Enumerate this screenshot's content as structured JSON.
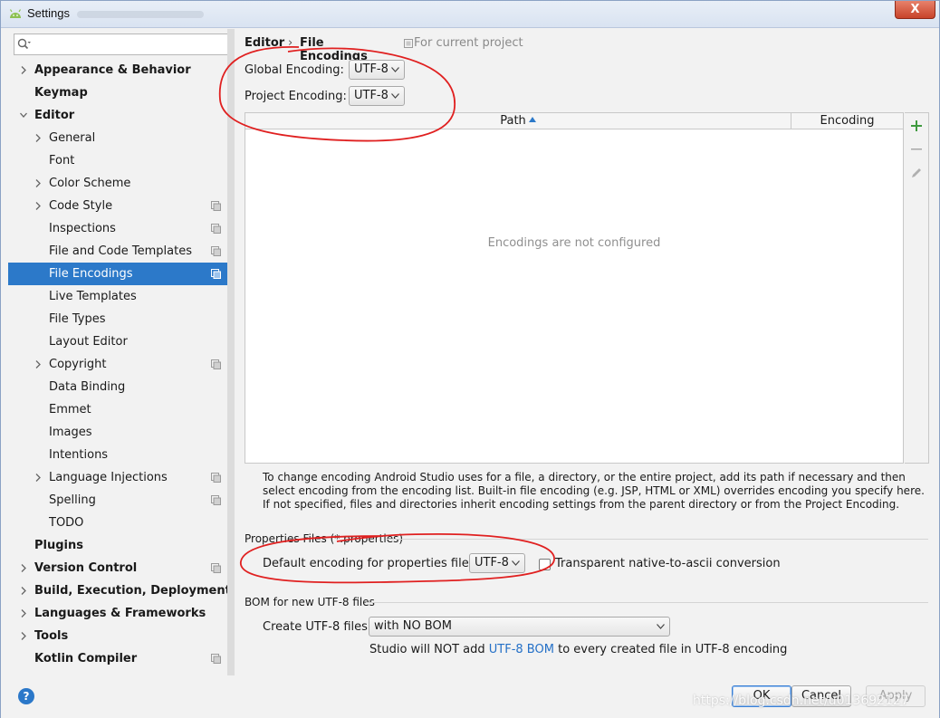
{
  "window": {
    "title": "Settings",
    "close_label": "X"
  },
  "sidebar": {
    "search_placeholder": "",
    "items": [
      {
        "label": "Appearance & Behavior",
        "bold": true,
        "chevron": "right",
        "level": 0,
        "project": false
      },
      {
        "label": "Keymap",
        "bold": true,
        "chevron": "none",
        "level": 0,
        "project": false
      },
      {
        "label": "Editor",
        "bold": true,
        "chevron": "down",
        "level": 0,
        "project": false
      },
      {
        "label": "General",
        "bold": false,
        "chevron": "right",
        "level": 1,
        "project": false
      },
      {
        "label": "Font",
        "bold": false,
        "chevron": "none",
        "level": 1,
        "project": false
      },
      {
        "label": "Color Scheme",
        "bold": false,
        "chevron": "right",
        "level": 1,
        "project": false
      },
      {
        "label": "Code Style",
        "bold": false,
        "chevron": "right",
        "level": 1,
        "project": true
      },
      {
        "label": "Inspections",
        "bold": false,
        "chevron": "none",
        "level": 1,
        "project": true
      },
      {
        "label": "File and Code Templates",
        "bold": false,
        "chevron": "none",
        "level": 1,
        "project": true
      },
      {
        "label": "File Encodings",
        "bold": false,
        "chevron": "none",
        "level": 1,
        "project": true,
        "selected": true
      },
      {
        "label": "Live Templates",
        "bold": false,
        "chevron": "none",
        "level": 1,
        "project": false
      },
      {
        "label": "File Types",
        "bold": false,
        "chevron": "none",
        "level": 1,
        "project": false
      },
      {
        "label": "Layout Editor",
        "bold": false,
        "chevron": "none",
        "level": 1,
        "project": false
      },
      {
        "label": "Copyright",
        "bold": false,
        "chevron": "right",
        "level": 1,
        "project": true
      },
      {
        "label": "Data Binding",
        "bold": false,
        "chevron": "none",
        "level": 1,
        "project": false
      },
      {
        "label": "Emmet",
        "bold": false,
        "chevron": "none",
        "level": 1,
        "project": false
      },
      {
        "label": "Images",
        "bold": false,
        "chevron": "none",
        "level": 1,
        "project": false
      },
      {
        "label": "Intentions",
        "bold": false,
        "chevron": "none",
        "level": 1,
        "project": false
      },
      {
        "label": "Language Injections",
        "bold": false,
        "chevron": "right",
        "level": 1,
        "project": true
      },
      {
        "label": "Spelling",
        "bold": false,
        "chevron": "none",
        "level": 1,
        "project": true
      },
      {
        "label": "TODO",
        "bold": false,
        "chevron": "none",
        "level": 1,
        "project": false
      },
      {
        "label": "Plugins",
        "bold": true,
        "chevron": "none",
        "level": 0,
        "project": false
      },
      {
        "label": "Version Control",
        "bold": true,
        "chevron": "right",
        "level": 0,
        "project": true
      },
      {
        "label": "Build, Execution, Deployment",
        "bold": true,
        "chevron": "right",
        "level": 0,
        "project": false
      },
      {
        "label": "Languages & Frameworks",
        "bold": true,
        "chevron": "right",
        "level": 0,
        "project": false
      },
      {
        "label": "Tools",
        "bold": true,
        "chevron": "right",
        "level": 0,
        "project": false
      },
      {
        "label": "Kotlin Compiler",
        "bold": true,
        "chevron": "none",
        "level": 0,
        "project": true
      }
    ]
  },
  "breadcrumb": {
    "parent": "Editor",
    "separator": "›",
    "current": "File Encodings",
    "scope": "For current project"
  },
  "encodings": {
    "global_label": "Global Encoding:",
    "global_value": "UTF-8",
    "project_label": "Project Encoding:",
    "project_value": "UTF-8"
  },
  "table": {
    "col_path": "Path",
    "col_encoding": "Encoding",
    "empty_text": "Encodings are not configured"
  },
  "help_text": "To change encoding Android Studio uses for a file, a directory, or the entire project, add its path if necessary and then select encoding from the encoding list. Built-in file encoding (e.g. JSP, HTML or XML) overrides encoding you specify here. If not specified, files and directories inherit encoding settings from the parent directory or from the Project Encoding.",
  "properties": {
    "section_title": "Properties Files (*.properties)",
    "default_label": "Default encoding for properties files:",
    "default_value": "UTF-8",
    "transparent_label": "Transparent native-to-ascii conversion",
    "transparent_checked": false
  },
  "bom": {
    "section_title": "BOM for new UTF-8 files",
    "create_label": "Create UTF-8 files:",
    "create_value": "with NO BOM",
    "note_prefix": "Studio will NOT add",
    "note_link": "UTF-8 BOM",
    "note_suffix": "to every created file in UTF-8 encoding"
  },
  "buttons": {
    "help": "?",
    "ok": "OK",
    "cancel": "Cancel",
    "apply": "Apply"
  },
  "watermark": "https://blog.csdn.net/u013692127",
  "colors": {
    "selection": "#2c79c9",
    "link": "#2470c7",
    "annotation": "#e02020",
    "add_icon": "#3f9a3f"
  }
}
